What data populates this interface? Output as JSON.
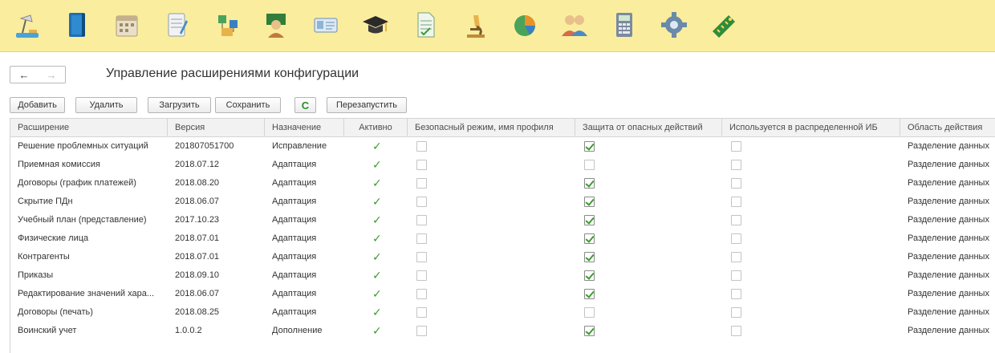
{
  "sections": [
    {
      "icon": "desk-lamp-icon"
    },
    {
      "icon": "book-icon"
    },
    {
      "icon": "calendar-icon"
    },
    {
      "icon": "notepad-icon"
    },
    {
      "icon": "structure-icon"
    },
    {
      "icon": "teacher-icon"
    },
    {
      "icon": "id-card-icon"
    },
    {
      "icon": "graduation-cap-icon"
    },
    {
      "icon": "document-icon"
    },
    {
      "icon": "microscope-icon"
    },
    {
      "icon": "pie-chart-icon"
    },
    {
      "icon": "users-icon"
    },
    {
      "icon": "calculator-icon"
    },
    {
      "icon": "gear-icon"
    },
    {
      "icon": "ruler-tag-icon"
    }
  ],
  "nav": {
    "back": "←",
    "forward": "→"
  },
  "page_title": "Управление расширениями конфигурации",
  "toolbar": {
    "add": "Добавить",
    "delete": "Удалить",
    "load": "Загрузить",
    "save": "Сохранить",
    "refresh_icon": "C",
    "restart": "Перезапустить"
  },
  "table": {
    "columns": [
      "Расширение",
      "Версия",
      "Назначение",
      "Активно",
      "Безопасный режим, имя профиля",
      "Защита от опасных действий",
      "Используется в распределенной ИБ",
      "Область действия"
    ],
    "rows": [
      {
        "name": "Решение проблемных ситуаций",
        "version": "201807051700",
        "purpose": "Исправление",
        "active": true,
        "safe_mode": false,
        "protection": true,
        "distributed": false,
        "scope": "Разделение данных"
      },
      {
        "name": "Приемная комиссия",
        "version": "2018.07.12",
        "purpose": "Адаптация",
        "active": true,
        "safe_mode": false,
        "protection": false,
        "distributed": false,
        "scope": "Разделение данных"
      },
      {
        "name": "Договоры (график платежей)",
        "version": "2018.08.20",
        "purpose": "Адаптация",
        "active": true,
        "safe_mode": false,
        "protection": true,
        "distributed": false,
        "scope": "Разделение данных"
      },
      {
        "name": "Скрытие ПДн",
        "version": "2018.06.07",
        "purpose": "Адаптация",
        "active": true,
        "safe_mode": false,
        "protection": true,
        "distributed": false,
        "scope": "Разделение данных"
      },
      {
        "name": "Учебный план (представление)",
        "version": "2017.10.23",
        "purpose": "Адаптация",
        "active": true,
        "safe_mode": false,
        "protection": true,
        "distributed": false,
        "scope": "Разделение данных"
      },
      {
        "name": "Физические лица",
        "version": "2018.07.01",
        "purpose": "Адаптация",
        "active": true,
        "safe_mode": false,
        "protection": true,
        "distributed": false,
        "scope": "Разделение данных"
      },
      {
        "name": "Контрагенты",
        "version": "2018.07.01",
        "purpose": "Адаптация",
        "active": true,
        "safe_mode": false,
        "protection": true,
        "distributed": false,
        "scope": "Разделение данных"
      },
      {
        "name": "Приказы",
        "version": "2018.09.10",
        "purpose": "Адаптация",
        "active": true,
        "safe_mode": false,
        "protection": true,
        "distributed": false,
        "scope": "Разделение данных"
      },
      {
        "name": "Редактирование значений хара...",
        "version": "2018.06.07",
        "purpose": "Адаптация",
        "active": true,
        "safe_mode": false,
        "protection": true,
        "distributed": false,
        "scope": "Разделение данных"
      },
      {
        "name": "Договоры (печать)",
        "version": "2018.08.25",
        "purpose": "Адаптация",
        "active": true,
        "safe_mode": false,
        "protection": false,
        "distributed": false,
        "scope": "Разделение данных"
      },
      {
        "name": "Воинский учет",
        "version": "1.0.0.2",
        "purpose": "Дополнение",
        "active": true,
        "safe_mode": false,
        "protection": true,
        "distributed": false,
        "scope": "Разделение данных"
      }
    ]
  },
  "colors": {
    "panel": "#fbed9e",
    "check": "#3d9b2f",
    "header_bg": "#f2f2f2",
    "border": "#d4d4d4"
  }
}
